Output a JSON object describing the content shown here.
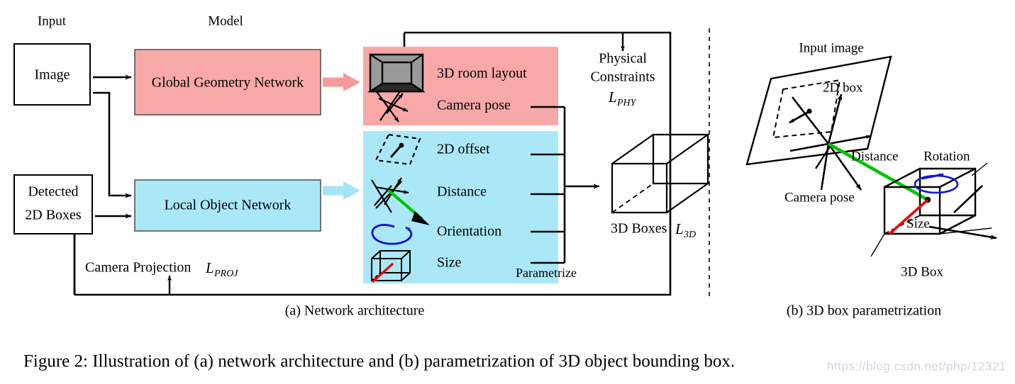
{
  "figure": {
    "caption": "Figure 2: Illustration of (a) network architecture and (b) parametrization of 3D object bounding box.",
    "subcaption_a": "(a) Network architecture",
    "subcaption_b": "(b) 3D box parametrization",
    "watermark": "https://blog.csdn.net/php/12321"
  },
  "colors": {
    "pink_panel": "#f9a8a8",
    "blue_panel": "#aae8f8",
    "pink_arrow": "#f79a9a",
    "blue_arrow": "#a5e4f7",
    "room_wall": "#9a9a9a",
    "room_floor": "#2b2b2b",
    "green": "#00c400",
    "red": "#ee0000",
    "blue_rot": "#1414d2",
    "stroke": "#000000",
    "watermark": "#cfd6e0"
  },
  "panel_a": {
    "headers": {
      "input": "Input",
      "model": "Model"
    },
    "input_boxes": [
      {
        "id": "image",
        "label": "Image"
      },
      {
        "id": "detected-2d-boxes",
        "line1": "Detected",
        "line2": "2D Boxes"
      }
    ],
    "networks": [
      {
        "id": "global-geometry-network",
        "label": "Global Geometry Network",
        "color": "#f9a8a8"
      },
      {
        "id": "local-object-network",
        "label": "Local Object Network",
        "color": "#aae8f8"
      }
    ],
    "global_outputs": [
      {
        "id": "3d-room-layout",
        "label": "3D room layout",
        "icon": "room-layout-icon"
      },
      {
        "id": "camera-pose",
        "label": "Camera pose",
        "icon": "camera-pose-axes-icon"
      }
    ],
    "local_outputs": [
      {
        "id": "2d-offset",
        "label": "2D offset",
        "icon": "dashed-quad-offset-icon"
      },
      {
        "id": "distance",
        "label": "Distance",
        "icon": "distance-axes-icon"
      },
      {
        "id": "orientation",
        "label": "Orientation",
        "icon": "rotation-arrow-icon"
      },
      {
        "id": "size",
        "label": "Size",
        "icon": "cube-size-icon"
      }
    ],
    "merge_label": "Parametrize",
    "physical_constraints": {
      "line1": "Physical",
      "line2": "Constraints",
      "loss": "L_PHY",
      "loss_base": "L",
      "loss_sub": "PHY"
    },
    "output": {
      "label": "3D Boxes",
      "loss_base": "L",
      "loss_sub": "3D"
    },
    "projection": {
      "label": "Camera Projection",
      "loss_base": "L",
      "loss_sub": "PROJ"
    }
  },
  "panel_b": {
    "labels": [
      {
        "id": "input-image",
        "text": "Input image"
      },
      {
        "id": "2d-box",
        "text": "2D box"
      },
      {
        "id": "distance",
        "text": "Distance"
      },
      {
        "id": "rotation",
        "text": "Rotation"
      },
      {
        "id": "camera-pose",
        "text": "Camera pose"
      },
      {
        "id": "size",
        "text": "Size"
      },
      {
        "id": "3d-box",
        "text": "3D Box"
      }
    ]
  }
}
